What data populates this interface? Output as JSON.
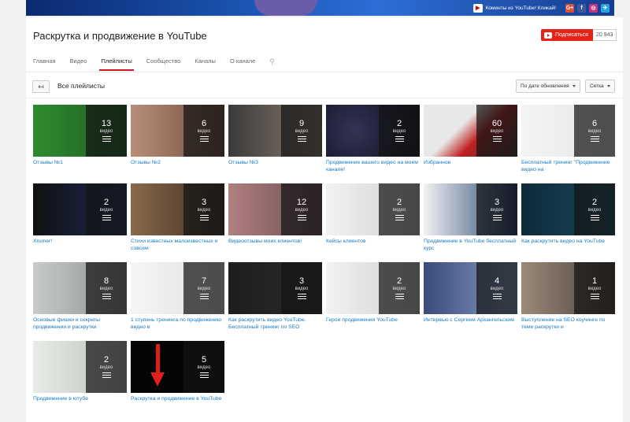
{
  "banner": {
    "link_text": "Коменты из YouTube! Кликай!",
    "social": [
      {
        "name": "google-plus",
        "glyph": "G+",
        "color": "#dd4b39"
      },
      {
        "name": "facebook",
        "glyph": "f",
        "color": "#3b5998"
      },
      {
        "name": "instagram",
        "glyph": "◎",
        "color": "#c13584"
      },
      {
        "name": "vk",
        "glyph": "✈",
        "color": "#2aa3e0"
      }
    ]
  },
  "channel": {
    "title": "Раскрутка и продвижение в YouTube",
    "subscribe_label": "Подписаться",
    "subscriber_count": "20 943"
  },
  "tabs": [
    {
      "label": "Главная",
      "active": false
    },
    {
      "label": "Видео",
      "active": false
    },
    {
      "label": "Плейлисты",
      "active": true
    },
    {
      "label": "Сообщество",
      "active": false
    },
    {
      "label": "Каналы",
      "active": false
    },
    {
      "label": "О канале",
      "active": false
    }
  ],
  "toolbar": {
    "back_glyph": "↤",
    "section_title": "Все плейлисты",
    "sort_label": "По дате обновления",
    "view_label": "Сетка"
  },
  "playlists": [
    {
      "title": "Отзывы №1",
      "count": "13",
      "count_label": "видео",
      "bg": "linear-gradient(90deg,#2f8a2f,#1d5e22)"
    },
    {
      "title": "Отзывы №2",
      "count": "6",
      "count_label": "видео",
      "bg": "linear-gradient(90deg,#b88e78,#6e4b3c)"
    },
    {
      "title": "Отзывы №3",
      "count": "9",
      "count_label": "видео",
      "bg": "linear-gradient(90deg,#3a3a3a,#8a7c6e)"
    },
    {
      "title": "Продвижение вашего видео на моем канале!",
      "count": "2",
      "count_label": "видео",
      "bg": "radial-gradient(circle at 30% 50%,#335,#0a0a1a)"
    },
    {
      "title": "Избранное",
      "count": "60",
      "count_label": "видео",
      "bg": "linear-gradient(135deg,#e8e8e8 40%,#c02020 60%,#333)"
    },
    {
      "title": "Бесплатный тренинг \"Продвижение видео на",
      "count": "6",
      "count_label": "видео",
      "bg": "linear-gradient(90deg,#f4f4f4,#e6e6e6)"
    },
    {
      "title": "Xrumer!",
      "count": "2",
      "count_label": "видео",
      "bg": "linear-gradient(90deg,#111,#1a2a55)"
    },
    {
      "title": "Стихи известных малоизвестных и совсем",
      "count": "3",
      "count_label": "видео",
      "bg": "linear-gradient(90deg,#8a6a4a,#3a2a20)"
    },
    {
      "title": "Видеоотзывы моих клиентов!",
      "count": "12",
      "count_label": "видео",
      "bg": "linear-gradient(90deg,#b08080,#6a4a50)"
    },
    {
      "title": "Кейсы клиентов",
      "count": "2",
      "count_label": "видео",
      "bg": "linear-gradient(90deg,#f2f2f2,#cfcfcf)"
    },
    {
      "title": "Продвижение в YouTube бесплатный курс",
      "count": "3",
      "count_label": "видео",
      "bg": "linear-gradient(90deg,#f2f2f2,#1a3a6a)"
    },
    {
      "title": "Как раскрутить видео на YouTube",
      "count": "2",
      "count_label": "видео",
      "bg": "linear-gradient(90deg,#0e2a3a,#1a4a5a)"
    },
    {
      "title": "Основые фишки и секреты продвижения и раскрутки",
      "count": "8",
      "count_label": "видео",
      "bg": "linear-gradient(90deg,#c8ccc8,#8a8e90)"
    },
    {
      "title": "1 ступень тренинга по продвижению видео в",
      "count": "7",
      "count_label": "видео",
      "bg": "linear-gradient(90deg,#f6f6f6,#dedede)"
    },
    {
      "title": "Как раскрутить видео YouTube. Бесплатный тренинг по SEO",
      "count": "3",
      "count_label": "видео",
      "bg": "linear-gradient(90deg,#1e1e1e,#2a2a2a)"
    },
    {
      "title": "Герои продвижения YouTube",
      "count": "2",
      "count_label": "видео",
      "bg": "linear-gradient(90deg,#f2f2f2,#cfcfcf)"
    },
    {
      "title": "Интервью с Сергеем Архангельским",
      "count": "4",
      "count_label": "видео",
      "bg": "linear-gradient(90deg,#3a4a7a,#8aa0c8)"
    },
    {
      "title": "Выступление на SEO коучинге по теме раскрутки и",
      "count": "1",
      "count_label": "видео",
      "bg": "linear-gradient(90deg,#9a8a7a,#4a3e38)"
    },
    {
      "title": "Продвижение в ютубе",
      "count": "2",
      "count_label": "видео",
      "bg": "linear-gradient(90deg,#e8ece8,#b8c0b8)"
    },
    {
      "title": "Раскрутка и продвижение в YouTube",
      "count": "5",
      "count_label": "видео",
      "bg": "#050505",
      "highlighted": true
    }
  ],
  "colors": {
    "accent": "#cc181e",
    "link": "#167ac6",
    "arrow": "#e01e1e"
  }
}
